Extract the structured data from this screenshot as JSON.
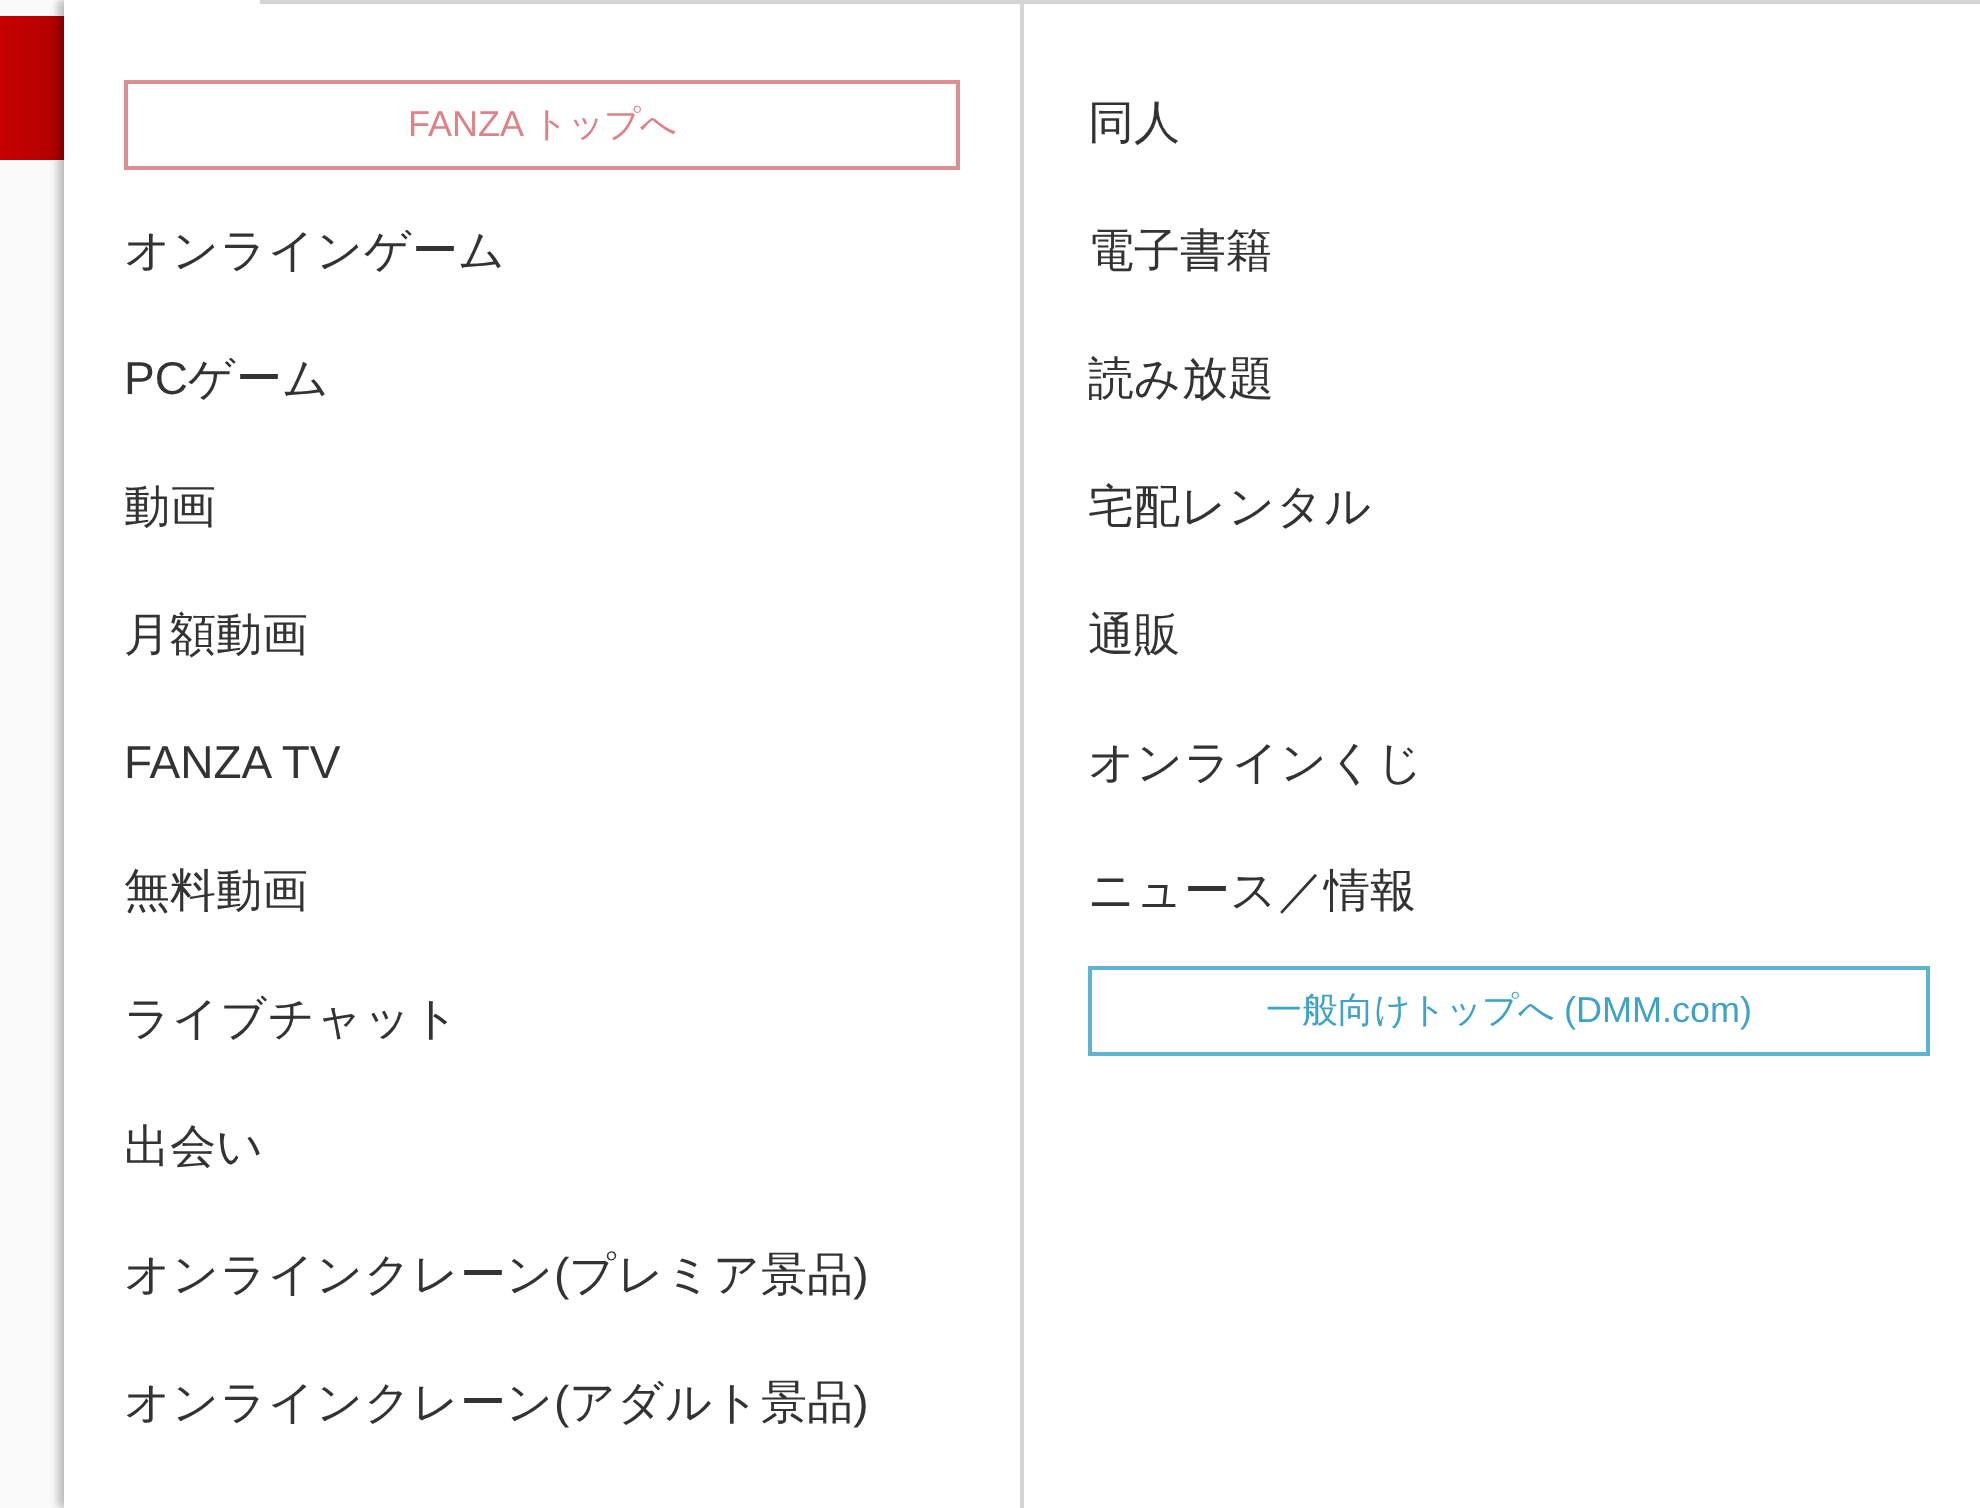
{
  "left_column": {
    "top_link": {
      "label": "FANZA トップへ"
    },
    "items": [
      "オンラインゲーム",
      "PCゲーム",
      "動画",
      "月額動画",
      "FANZA TV",
      "無料動画",
      "ライブチャット",
      "出会い",
      "オンラインクレーン(プレミア景品)",
      "オンラインクレーン(アダルト景品)"
    ]
  },
  "right_column": {
    "items": [
      "同人",
      "電子書籍",
      "読み放題",
      "宅配レンタル",
      "通販",
      "オンラインくじ",
      "ニュース／情報"
    ],
    "bottom_link": {
      "label": "一般向けトップへ (DMM.com)"
    }
  }
}
